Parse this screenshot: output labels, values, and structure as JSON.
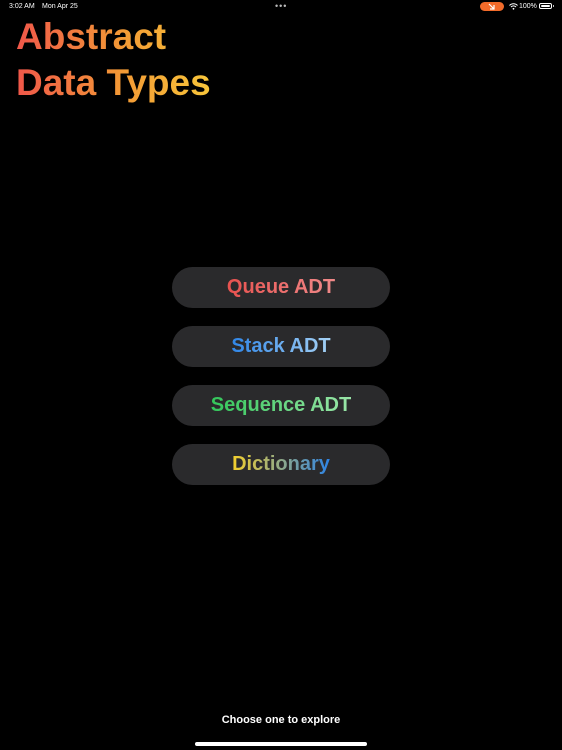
{
  "status_bar": {
    "time": "3:02 AM",
    "date": "Mon Apr 25",
    "multitask_indicator": "•••",
    "pip_icon": "arrow-diagonal-icon",
    "wifi_icon": "wifi-icon",
    "battery_percent": "100%",
    "battery_icon": "battery-icon",
    "pip_color": "#f26b2a"
  },
  "title": {
    "line1": "Abstract",
    "line2": "Data Types",
    "gradient_colors": [
      "#f0574a",
      "#f39a35",
      "#f8c63a"
    ]
  },
  "menu": {
    "items": [
      {
        "label": "Queue ADT",
        "colors": [
          "#e8524f",
          "#f08a8a"
        ]
      },
      {
        "label": "Stack ADT",
        "colors": [
          "#2f86e8",
          "#a6d2f5"
        ]
      },
      {
        "label": "Sequence ADT",
        "colors": [
          "#33c65a",
          "#9ae5a8"
        ]
      },
      {
        "label": "Dictionary",
        "colors": [
          "#f4d02c",
          "#2c83e6"
        ]
      }
    ],
    "button_background": "#2a2a2c"
  },
  "footer": {
    "hint": "Choose one to explore"
  }
}
